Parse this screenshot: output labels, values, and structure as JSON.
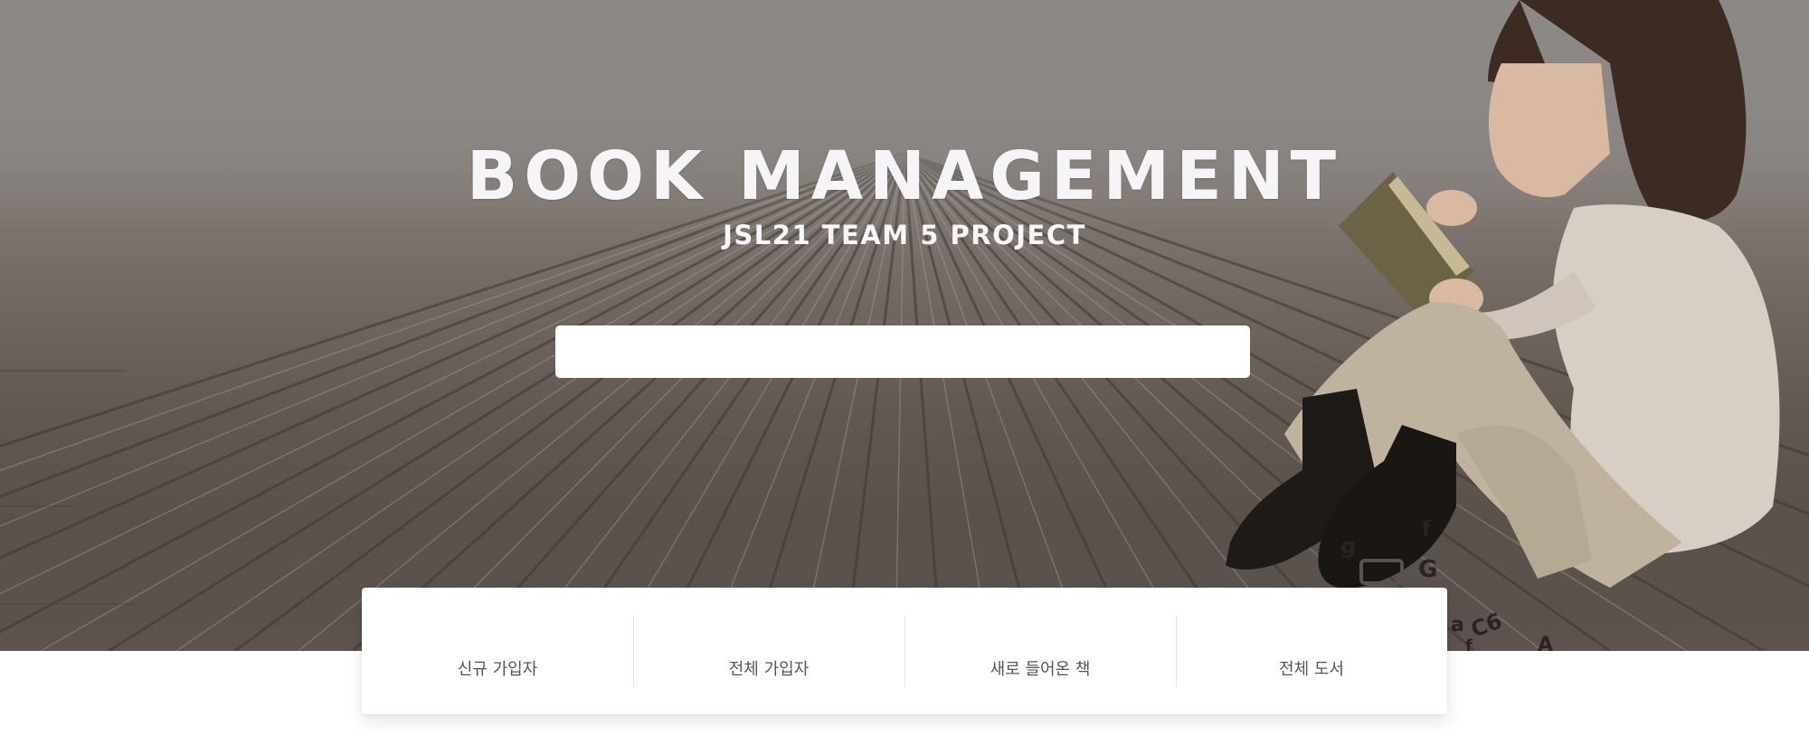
{
  "hero": {
    "title": "BOOK MANAGEMENT",
    "subtitle": "JSL21 TEAM 5 PROJECT",
    "search": {
      "value": "",
      "placeholder": ""
    }
  },
  "stats": {
    "items": [
      {
        "label": "신규 가입자"
      },
      {
        "label": "전체 가입자"
      },
      {
        "label": "새로 들어온 책"
      },
      {
        "label": "전체 도서"
      }
    ]
  },
  "colors": {
    "title_text": "#f6f4f6",
    "stat_label": "#555555",
    "card_bg": "#ffffff",
    "divider": "#e4e4e4"
  }
}
